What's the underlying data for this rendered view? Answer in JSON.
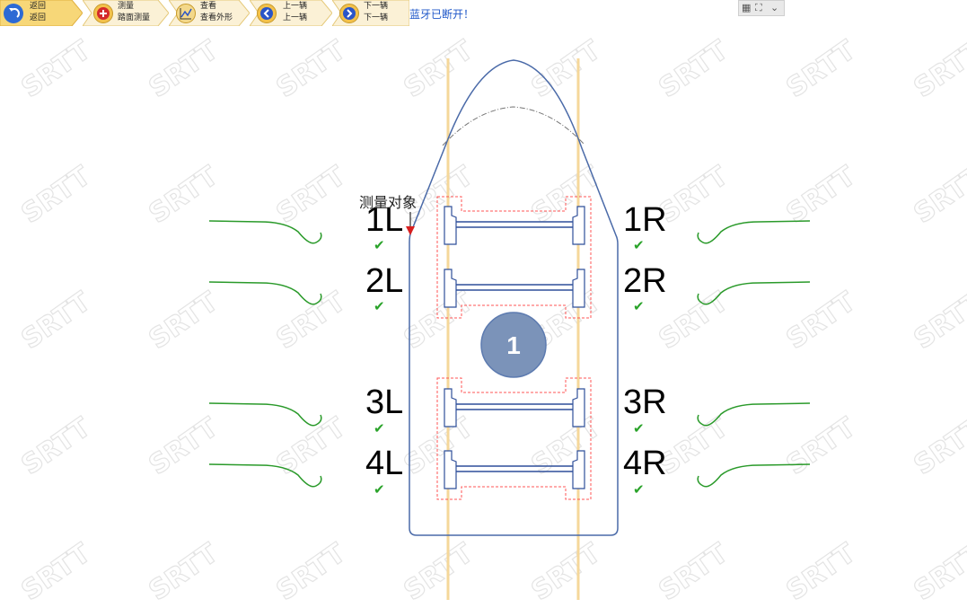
{
  "toolbar": {
    "back": {
      "line1": "返回",
      "line2": "返回",
      "icon": "undo-arrow-icon"
    },
    "measure": {
      "line1": "测量",
      "line2": "踏面测量",
      "icon": "plus-icon"
    },
    "view": {
      "line1": "查看",
      "line2": "查看外形",
      "icon": "chart-line-icon"
    },
    "prev": {
      "line1": "上一辆",
      "line2": "上一辆",
      "icon": "chevron-left-icon"
    },
    "next": {
      "line1": "下一辆",
      "line2": "下一辆",
      "icon": "chevron-right-icon"
    }
  },
  "status": {
    "bluetooth": "蓝牙已断开！"
  },
  "window_controls": {
    "grid": "▦",
    "expand": "⛶",
    "dropdown": "⌄"
  },
  "watermark": "SRTT",
  "diagram": {
    "target_label": "测量对象",
    "car_number": "1",
    "wheels": [
      {
        "label": "1L",
        "checked": true
      },
      {
        "label": "2L",
        "checked": true
      },
      {
        "label": "3L",
        "checked": true
      },
      {
        "label": "4L",
        "checked": true
      },
      {
        "label": "1R",
        "checked": true
      },
      {
        "label": "2R",
        "checked": true
      },
      {
        "label": "3R",
        "checked": true
      },
      {
        "label": "4R",
        "checked": true
      }
    ],
    "check_mark": "✔",
    "colors": {
      "hull": "#4a6aa8",
      "axle": "#2f4f9a",
      "rail": "#f5d79a",
      "dashed_frame": "#ff5555",
      "profile": "#2a9a2a",
      "circle_fill": "#7b93b9",
      "pointer": "#d81f1f"
    }
  }
}
